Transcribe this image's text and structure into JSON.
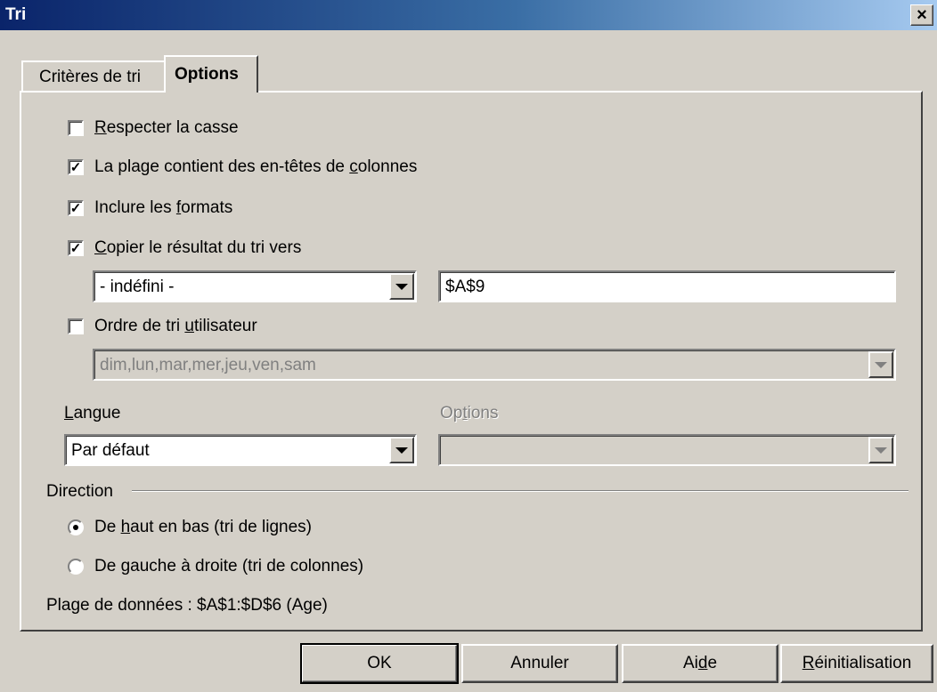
{
  "window": {
    "title": "Tri",
    "close_label": "×"
  },
  "tabs": [
    {
      "label": "Critères de tri"
    },
    {
      "label": "Options"
    }
  ],
  "options": {
    "case_sensitive": {
      "label_pre": "",
      "label_key": "R",
      "label_post": "especter la casse",
      "checked": false
    },
    "headers": {
      "label_pre": "La plage contient des en-têtes de ",
      "label_key": "c",
      "label_post": "olonnes",
      "checked": true
    },
    "include_formats": {
      "label_pre": "Inclure les ",
      "label_key": "f",
      "label_post": "ormats",
      "checked": true
    },
    "copy_result": {
      "label_pre": "",
      "label_key": "C",
      "label_post": "opier le résultat du tri vers",
      "checked": true
    },
    "copy_target_select": "- indéfini -",
    "copy_target_input": "$A$9",
    "custom_order": {
      "label_pre": "Ordre de tri ",
      "label_key": "u",
      "label_post": "tilisateur",
      "checked": false
    },
    "custom_order_select": "dim,lun,mar,mer,jeu,ven,sam",
    "language_label_key": "L",
    "language_label_post": "angue",
    "language_value": "Par défaut",
    "options_label_pre": "Op",
    "options_label_key": "t",
    "options_label_post": "ions",
    "options_value": ""
  },
  "direction": {
    "label": "Direction",
    "top_bottom": {
      "label_pre": "De ",
      "label_key": "h",
      "label_post": "aut en bas (tri de lignes)",
      "selected": true
    },
    "left_right": {
      "label_pre": "De ",
      "label_key": "g",
      "label_post": "auche à droite (tri de colonnes)",
      "selected": false
    }
  },
  "data_range": "Plage de données : $A$1:$D$6 (Age)",
  "buttons": {
    "ok": "OK",
    "cancel": "Annuler",
    "help_pre": "Ai",
    "help_key": "d",
    "help_post": "e",
    "reset_key": "R",
    "reset_post": "éinitialisation"
  },
  "check_mark": "✓"
}
